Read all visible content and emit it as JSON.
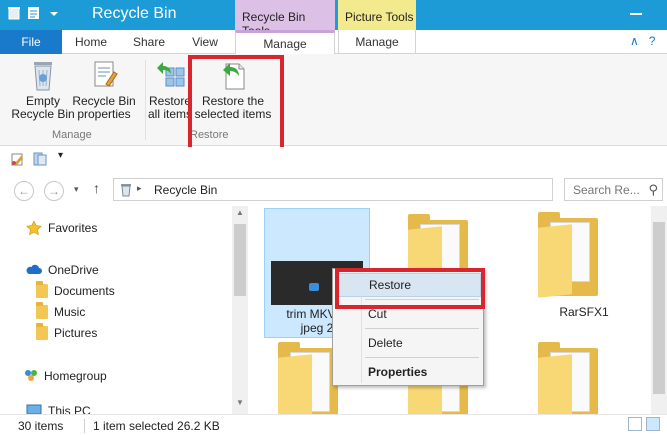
{
  "window": {
    "title": "Recycle Bin",
    "context_tab_recycle": "Recycle Bin Tools",
    "context_tab_picture": "Picture Tools"
  },
  "tabs": {
    "file": "File",
    "home": "Home",
    "share": "Share",
    "view": "View",
    "manage_recycle": "Manage",
    "manage_picture": "Manage"
  },
  "ribbon": {
    "empty_line1": "Empty",
    "empty_line2": "Recycle Bin",
    "props_line1": "Recycle Bin",
    "props_line2": "properties",
    "group_manage": "Manage",
    "restore_all_line1": "Restore",
    "restore_all_line2": "all items",
    "restore_sel_line1": "Restore the",
    "restore_sel_line2": "selected items",
    "group_restore": "Restore"
  },
  "address": {
    "path": "Recycle Bin",
    "search_placeholder": "Search Re..."
  },
  "nav": {
    "favorites": "Favorites",
    "onedrive": "OneDrive",
    "documents": "Documents",
    "music": "Music",
    "pictures": "Pictures",
    "homegroup": "Homegroup",
    "this_pc": "This PC"
  },
  "content": {
    "selected_line1": "trim MKV vi",
    "selected_line2": "jpeg 2",
    "rarsfx": "RarSFX1"
  },
  "context_menu": {
    "restore": "Restore",
    "cut": "Cut",
    "delete": "Delete",
    "properties": "Properties"
  },
  "status": {
    "count": "30 items",
    "selection": "1 item selected  26.2 KB"
  },
  "colors": {
    "titlebar": "#1d9bd7",
    "file_tab": "#1979ca",
    "recycle_tools": "#dcc0e6",
    "picture_tools": "#f3ea8e",
    "highlight_red": "#d9252e"
  }
}
